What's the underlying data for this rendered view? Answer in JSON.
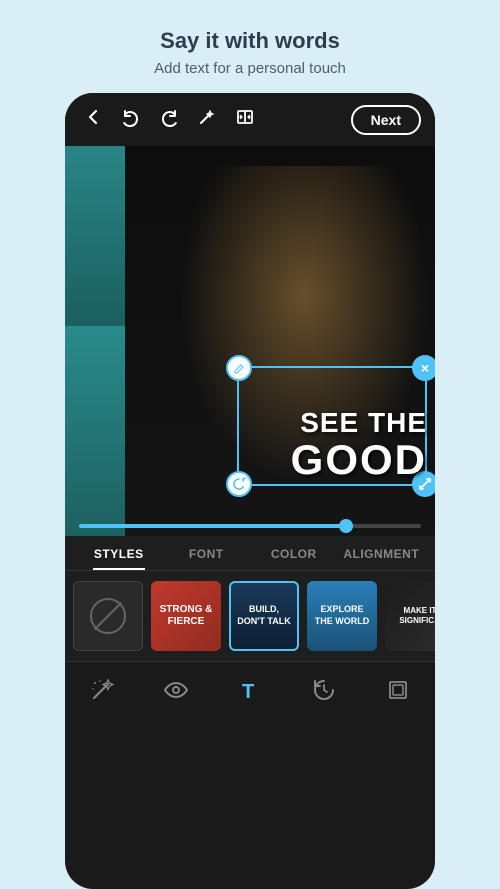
{
  "header": {
    "title": "Say it with words",
    "subtitle": "Add text for a personal touch"
  },
  "topbar": {
    "next_label": "Next",
    "icons": {
      "back": "←",
      "undo": "↩",
      "redo": "↪",
      "magic": "✦",
      "compare": "⊟"
    }
  },
  "image": {
    "overlay_line1": "SEE THE",
    "overlay_line2": "GOOD"
  },
  "tabs": [
    {
      "id": "styles",
      "label": "STYLES",
      "active": true
    },
    {
      "id": "font",
      "label": "FONT",
      "active": false
    },
    {
      "id": "color",
      "label": "COLOR",
      "active": false
    },
    {
      "id": "alignment",
      "label": "ALIGNMENT",
      "active": false
    }
  ],
  "presets": [
    {
      "id": "none",
      "label": "",
      "type": "none"
    },
    {
      "id": "strong",
      "label": "STRONG &\nFIERCE",
      "type": "strong"
    },
    {
      "id": "build",
      "label": "BUILD,\nDON'T TALK",
      "type": "build",
      "active": true
    },
    {
      "id": "explore",
      "label": "EXPLORE\nTHE WORLD",
      "type": "explore"
    },
    {
      "id": "make",
      "label": "MAKE IT\nSIGNIFIC...",
      "type": "make"
    }
  ],
  "toolbar": {
    "items": [
      {
        "id": "magic-wand",
        "icon": "✦",
        "active": false
      },
      {
        "id": "eye",
        "icon": "👁",
        "active": false
      },
      {
        "id": "text",
        "icon": "T",
        "active": true
      },
      {
        "id": "history",
        "icon": "↺",
        "active": false
      },
      {
        "id": "layers",
        "icon": "⊡",
        "active": false
      }
    ]
  },
  "slider": {
    "value": 78
  }
}
